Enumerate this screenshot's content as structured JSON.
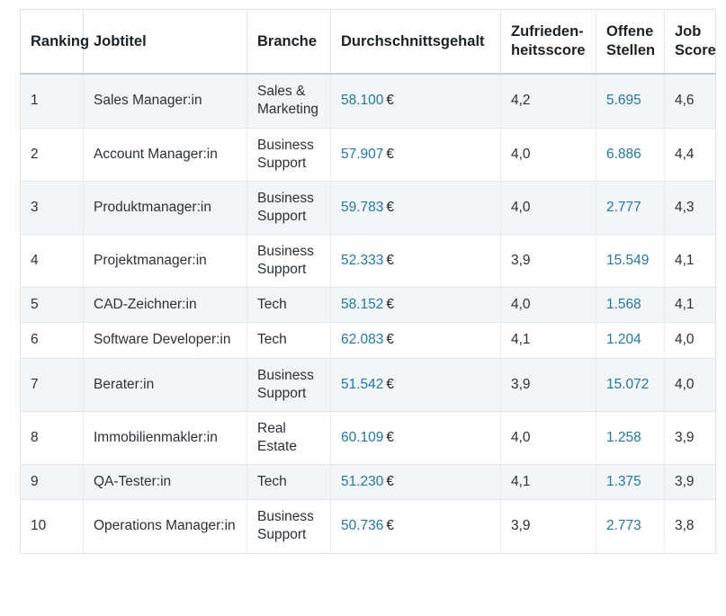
{
  "table": {
    "columns": [
      {
        "key": "ranking",
        "label": "Ranking"
      },
      {
        "key": "jobtitel",
        "label": "Jobtitel"
      },
      {
        "key": "branche",
        "label": "Branche"
      },
      {
        "key": "gehalt",
        "label": "Durchschnittsgehalt"
      },
      {
        "key": "zufried",
        "label": "Zufrieden-\nheitsscore"
      },
      {
        "key": "offene",
        "label": "Offene\nStellen"
      },
      {
        "key": "jobscore",
        "label": "Job\nScore"
      }
    ],
    "currency_symbol": "€",
    "link_color": "#2477a0",
    "shaded_row_color": "#f3f6f8",
    "rows": [
      {
        "ranking": "1",
        "jobtitel": "Sales Manager:in",
        "branche": "Sales & Marketing",
        "gehalt": "58.100",
        "zufried": "4,2",
        "offene": "5.695",
        "jobscore": "4,6"
      },
      {
        "ranking": "2",
        "jobtitel": "Account Manager:in",
        "branche": "Business Support",
        "gehalt": "57.907",
        "zufried": "4,0",
        "offene": "6.886",
        "jobscore": "4,4"
      },
      {
        "ranking": "3",
        "jobtitel": "Produktmanager:in",
        "branche": "Business Support",
        "gehalt": "59.783",
        "zufried": "4,0",
        "offene": "2.777",
        "jobscore": "4,3"
      },
      {
        "ranking": "4",
        "jobtitel": "Projektmanager:in",
        "branche": "Business Support",
        "gehalt": "52.333",
        "zufried": "3,9",
        "offene": "15.549",
        "jobscore": "4,1"
      },
      {
        "ranking": "5",
        "jobtitel": "CAD-Zeichner:in",
        "branche": "Tech",
        "gehalt": "58.152",
        "zufried": "4,0",
        "offene": "1.568",
        "jobscore": "4,1"
      },
      {
        "ranking": "6",
        "jobtitel": "Software Developer:in",
        "branche": "Tech",
        "gehalt": "62.083",
        "zufried": "4,1",
        "offene": "1.204",
        "jobscore": "4,0"
      },
      {
        "ranking": "7",
        "jobtitel": "Berater:in",
        "branche": "Business Support",
        "gehalt": "51.542",
        "zufried": "3,9",
        "offene": "15.072",
        "jobscore": "4,0"
      },
      {
        "ranking": "8",
        "jobtitel": "Immobilienmakler:in",
        "branche": "Real Estate",
        "gehalt": "60.109",
        "zufried": "4,0",
        "offene": "1.258",
        "jobscore": "3,9"
      },
      {
        "ranking": "9",
        "jobtitel": "QA-Tester:in",
        "branche": "Tech",
        "gehalt": "51.230",
        "zufried": "4,1",
        "offene": "1.375",
        "jobscore": "3,9"
      },
      {
        "ranking": "10",
        "jobtitel": "Operations Manager:in",
        "branche": "Business Support",
        "gehalt": "50.736",
        "zufried": "3,9",
        "offene": "2.773",
        "jobscore": "3,8"
      }
    ]
  }
}
